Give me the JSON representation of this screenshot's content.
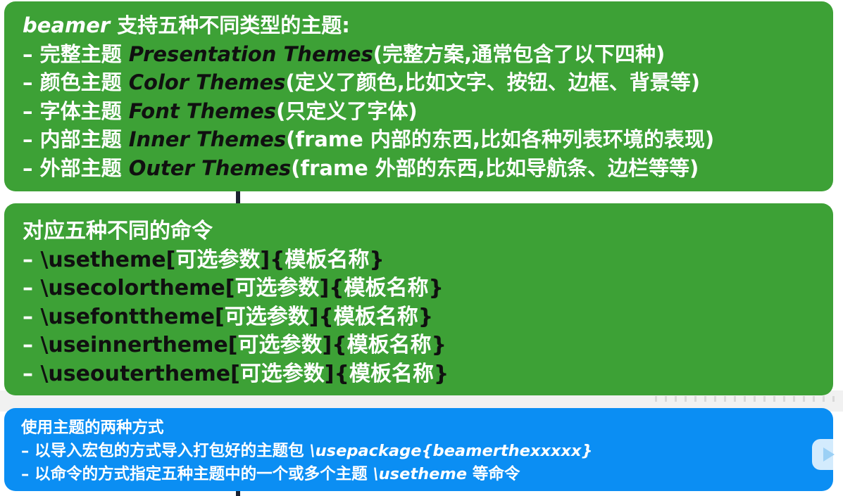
{
  "box1": {
    "title_en": "beamer",
    "title_zh": " 支持五种不同类型的主题:",
    "items": [
      {
        "dash": "– ",
        "zh": "完整主题 ",
        "en": "Presentation Themes",
        "note": "(完整方案,通常包含了以下四种)"
      },
      {
        "dash": "– ",
        "zh": "颜色主题 ",
        "en": "Color Themes",
        "note": "(定义了颜色,比如文字、按钮、边框、背景等)"
      },
      {
        "dash": "– ",
        "zh": "字体主题 ",
        "en": "Font Themes",
        "note": "(只定义了字体)"
      },
      {
        "dash": "– ",
        "zh": "内部主题 ",
        "en": "Inner Themes",
        "note": "(frame 内部的东西,比如各种列表环境的表现)"
      },
      {
        "dash": "– ",
        "zh": "外部主题 ",
        "en": "Outer Themes",
        "note": "(frame 外部的东西,比如导航条、边栏等等)"
      }
    ]
  },
  "box2": {
    "title": "对应五种不同的命令",
    "items": [
      {
        "dash": "– ",
        "cmd": "\\usetheme",
        "lb": "[",
        "opt": "可选参数",
        "rb": "]",
        "lc": "{",
        "name": "模板名称",
        "rc": "}"
      },
      {
        "dash": "– ",
        "cmd": "\\usecolortheme",
        "lb": "[",
        "opt": "可选参数",
        "rb": "]",
        "lc": "{",
        "name": "模板名称",
        "rc": "}"
      },
      {
        "dash": "– ",
        "cmd": "\\usefonttheme",
        "lb": "[",
        "opt": "可选参数",
        "rb": "]",
        "lc": "{",
        "name": "模板名称",
        "rc": "}"
      },
      {
        "dash": "– ",
        "cmd": "\\useinnertheme",
        "lb": "[",
        "opt": "可选参数",
        "rb": "]",
        "lc": "{",
        "name": "模板名称",
        "rc": "}"
      },
      {
        "dash": "– ",
        "cmd": "\\useoutertheme",
        "lb": "[",
        "opt": "可选参数",
        "rb": "]",
        "lc": "{",
        "name": "模板名称",
        "rc": "}"
      }
    ]
  },
  "box3": {
    "title": "使用主题的两种方式",
    "items": [
      {
        "dash": "– ",
        "pre": "以导入宏包的方式导入打包好的主题包 ",
        "code": "\\usepackage{beamerthexxxxx}",
        "post": ""
      },
      {
        "dash": "– ",
        "pre": "以命令的方式指定五种主题中的一个或多个主题 ",
        "code": "\\usetheme",
        "post": " 等命令"
      }
    ]
  },
  "colors": {
    "green_box": "#3da136",
    "blue_box": "#0b8ef3",
    "text_white": "#ffffff",
    "text_dark": "#101010"
  },
  "icons": {
    "video_overlay": "play-icon"
  }
}
